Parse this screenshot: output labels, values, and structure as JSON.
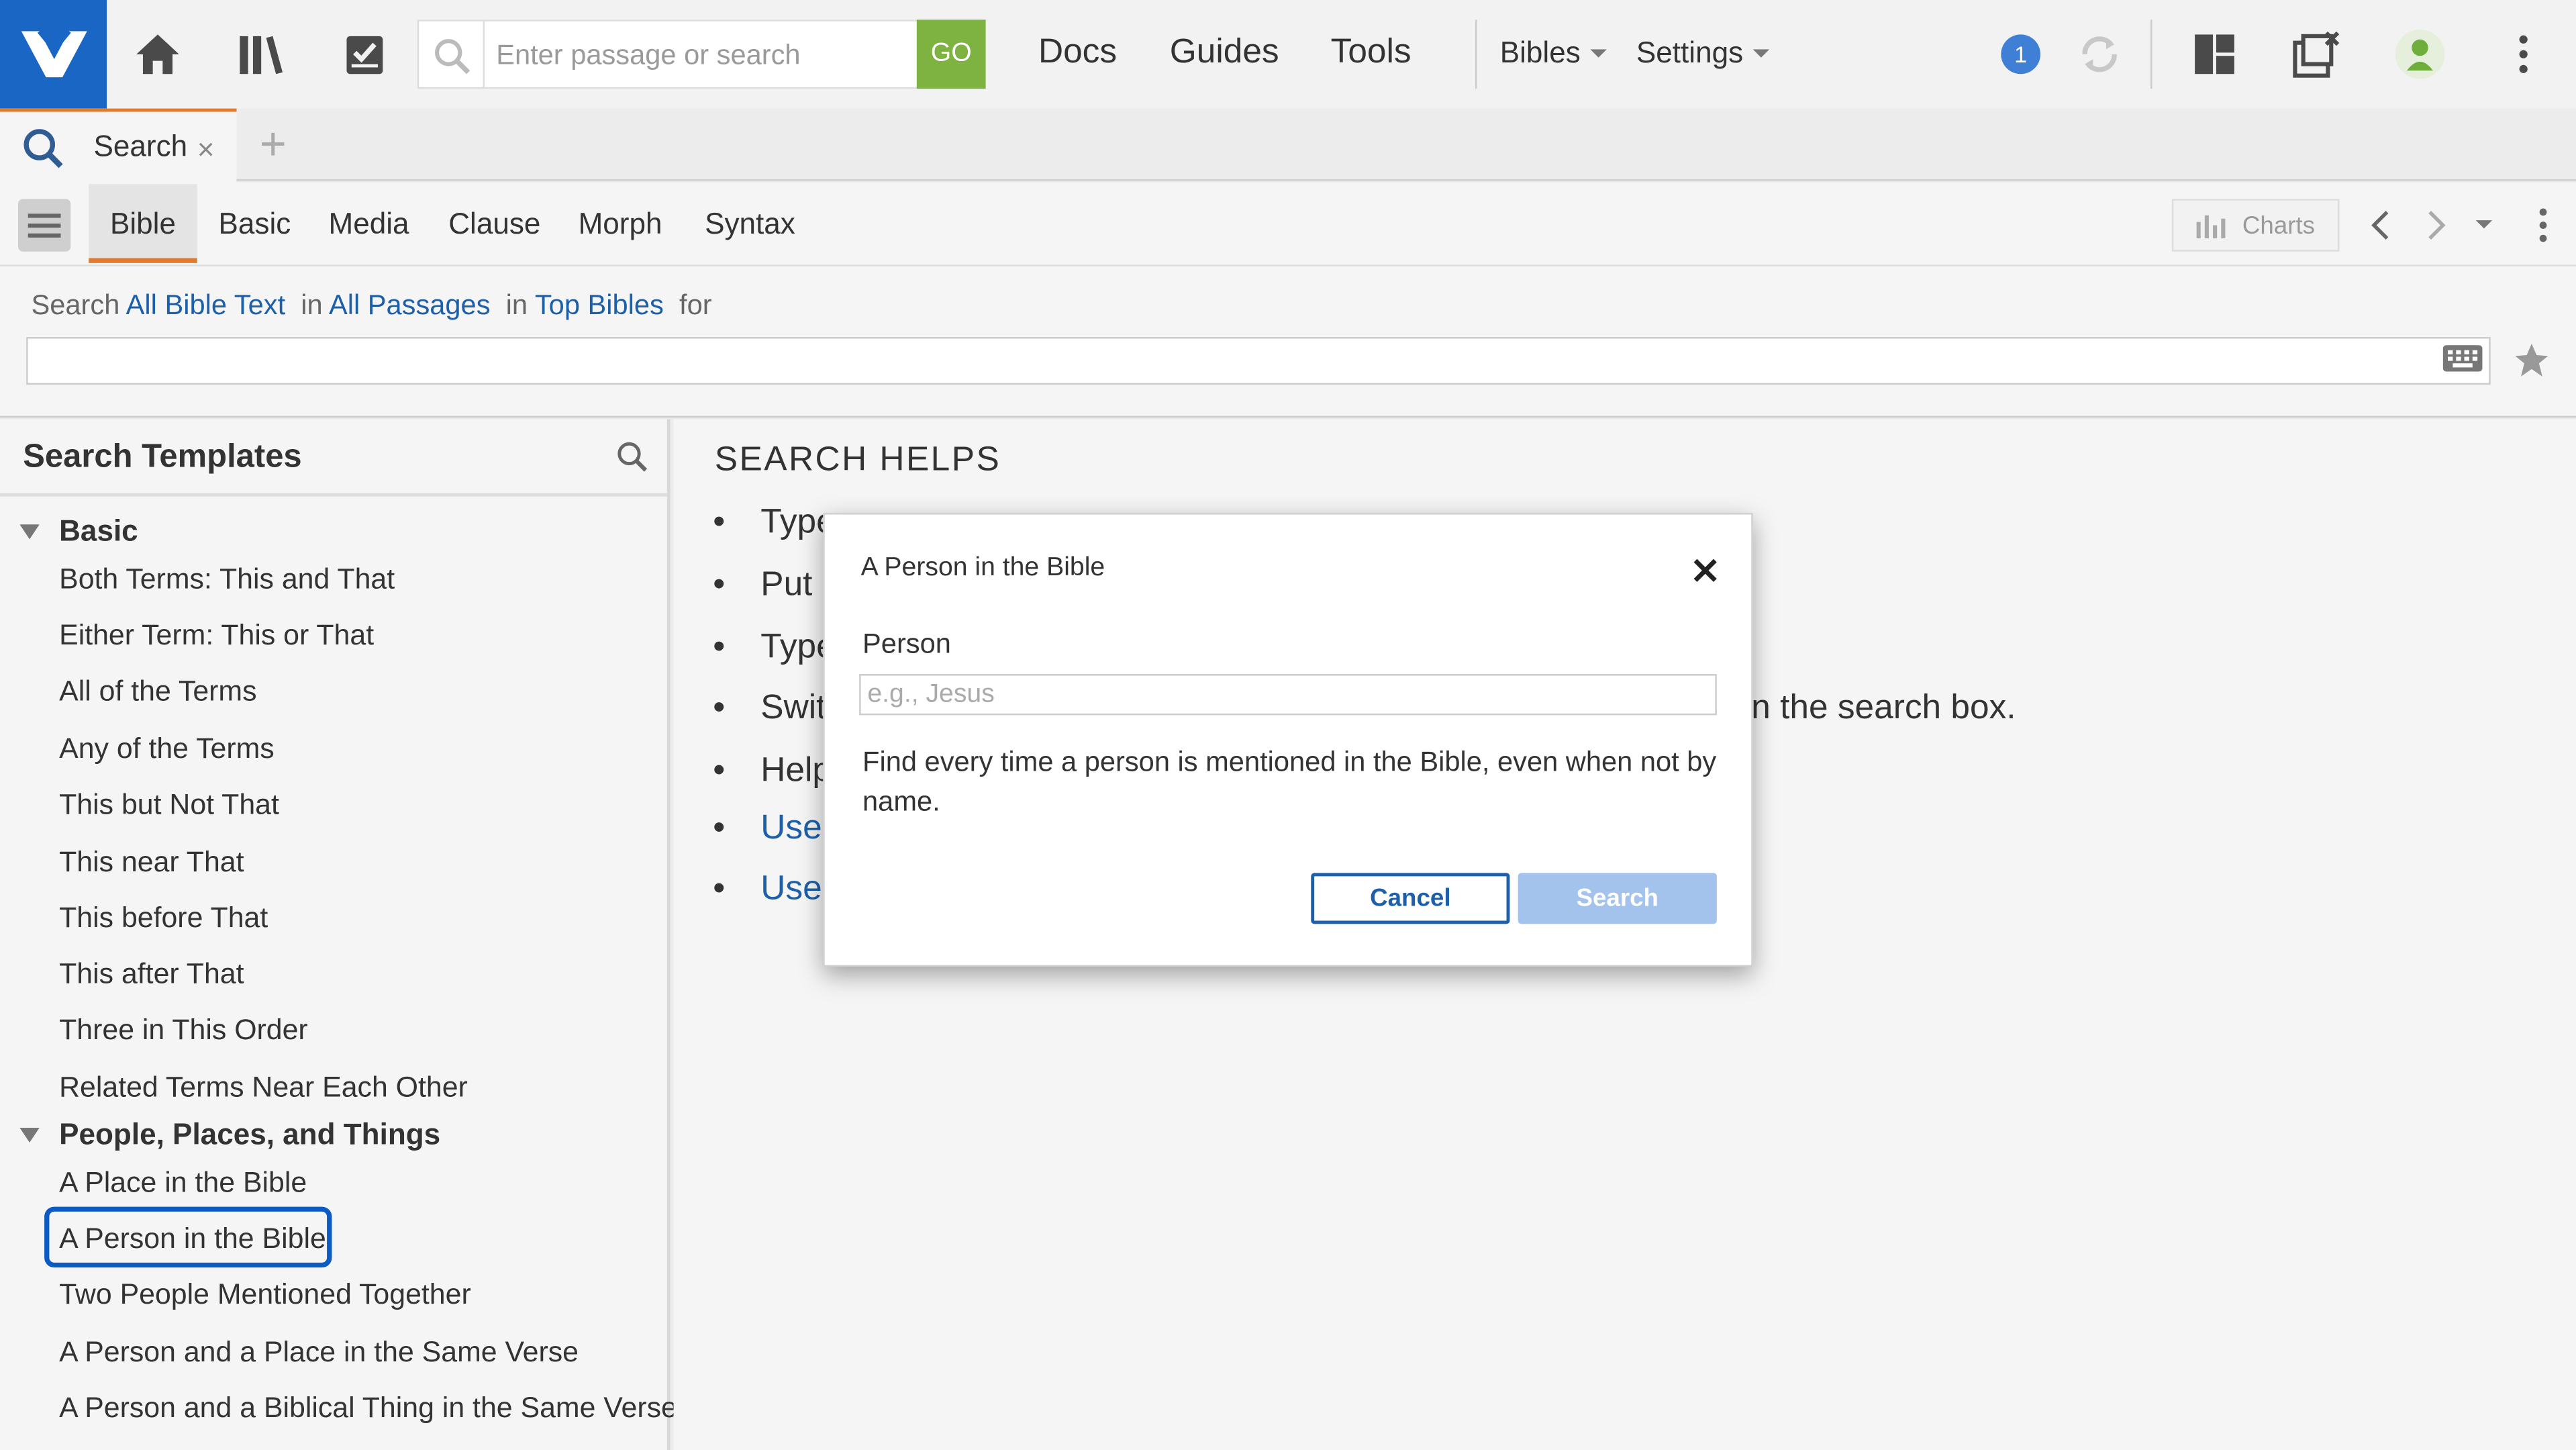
{
  "colors": {
    "brand": "#1a66c4",
    "accent": "#e07a2e",
    "go": "#7fb341",
    "link": "#1d5fa8",
    "selection": "#0b5bc3"
  },
  "topbar": {
    "icons": [
      "logos-logo-icon",
      "home-icon",
      "library-icon",
      "tasks-icon",
      "search-icon",
      "layouts-icon",
      "close-panels-icon",
      "user-icon",
      "more-vertical-icon",
      "sync-icon"
    ],
    "search_placeholder": "Enter passage or search",
    "go_label": "GO",
    "nav": {
      "docs": "Docs",
      "guides": "Guides",
      "tools": "Tools"
    },
    "menus": {
      "bibles": "Bibles",
      "settings": "Settings"
    },
    "notification_count": "1"
  },
  "tab": {
    "label": "Search",
    "close": "×",
    "add": "+"
  },
  "subtabs": {
    "bible": "Bible",
    "basic": "Basic",
    "media": "Media",
    "clause": "Clause",
    "morph": "Morph",
    "syntax": "Syntax"
  },
  "toolbar": {
    "charts": "Charts"
  },
  "query": {
    "search_word": "Search",
    "text_scope": "All Bible Text",
    "in1": "in",
    "passages": "All Passages",
    "in2": "in",
    "bibles": "Top Bibles",
    "for": "for"
  },
  "templates": {
    "header": "Search Templates",
    "groups": [
      {
        "name": "Basic",
        "items": [
          "Both Terms: This and That",
          "Either Term: This or That",
          "All of the Terms",
          "Any of the Terms",
          "This but Not That",
          "This near That",
          "This before That",
          "This after That",
          "Three in This Order",
          "Related Terms Near Each Other"
        ]
      },
      {
        "name": "People, Places, and Things",
        "items": [
          "A Place in the Bible",
          "A Person in the Bible",
          "Two People Mentioned Together",
          "A Person and a Place in the Same Verse",
          "A Person and a Biblical Thing in the Same Verse"
        ]
      }
    ],
    "selected": "A Person in the Bible"
  },
  "helps": {
    "title": "SEARCH HELPS",
    "rows": [
      "Type",
      "Put",
      "Type",
      "Swit",
      "Help",
      "Use",
      "Use"
    ],
    "fragment": "n the search box."
  },
  "dialog": {
    "title": "A Person in the Bible",
    "close": "×",
    "person_label": "Person",
    "person_placeholder": "e.g., Jesus",
    "description": "Find every time a person is mentioned in the Bible, even when not by name.",
    "cancel": "Cancel",
    "search": "Search"
  }
}
